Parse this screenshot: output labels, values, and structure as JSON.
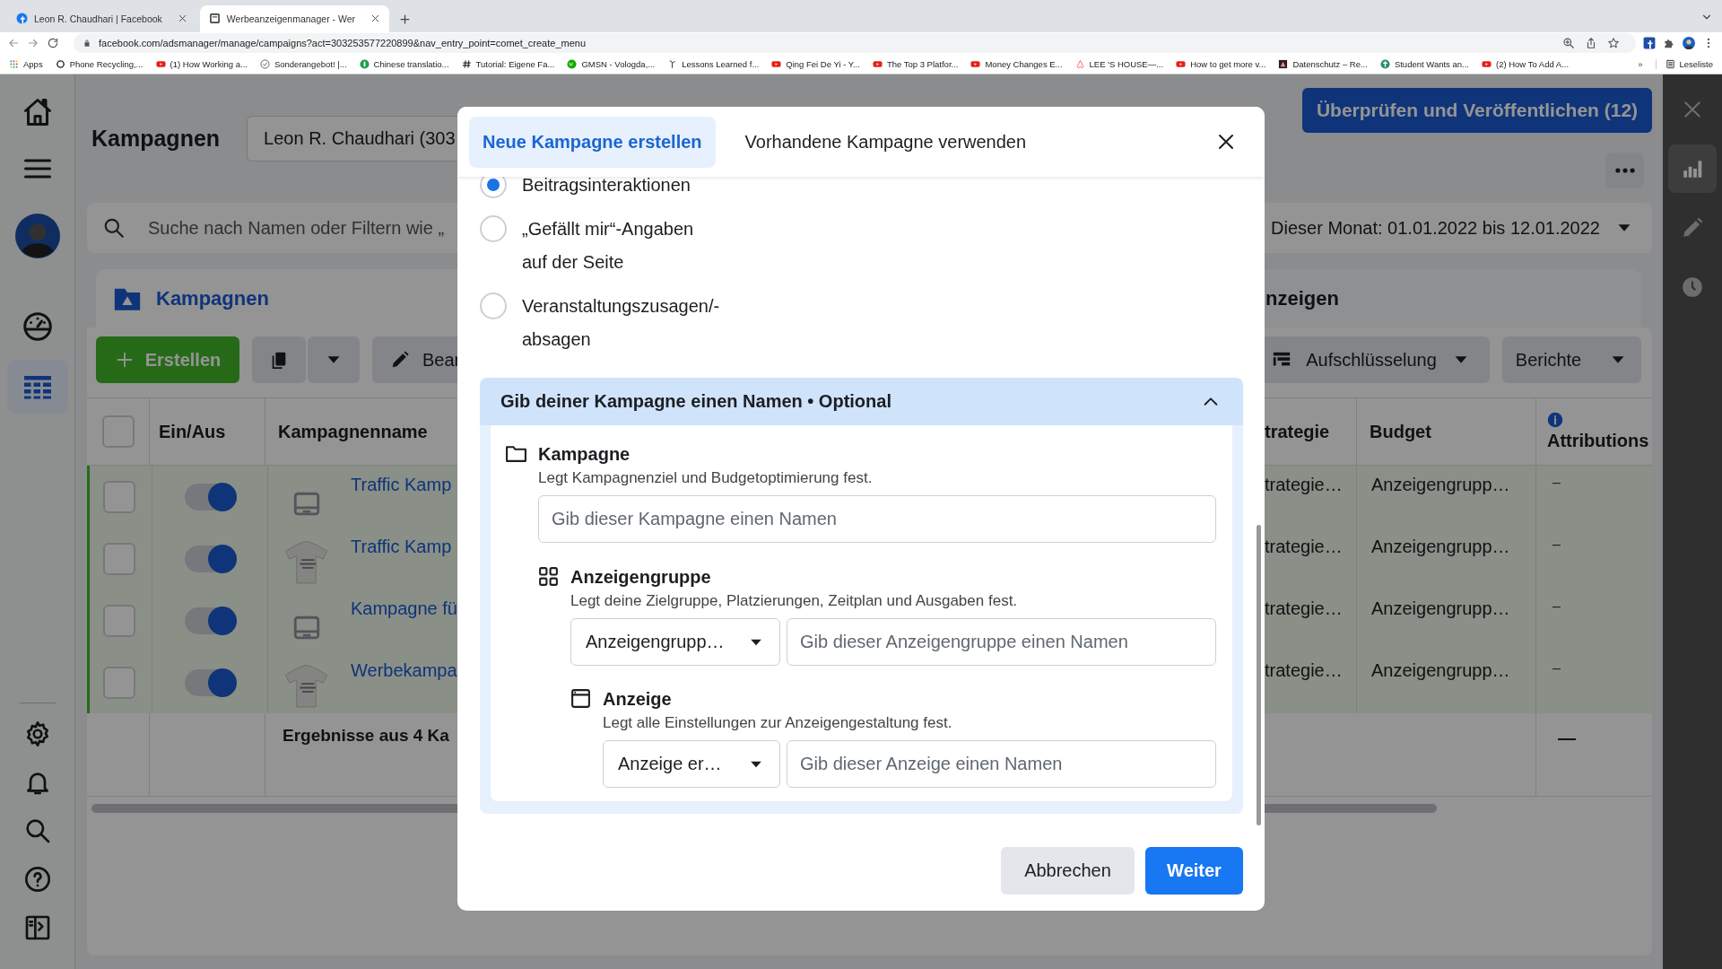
{
  "browser": {
    "tabs": [
      {
        "title": "Leon R. Chaudhari | Facebook",
        "selected": false
      },
      {
        "title": "Werbeanzeigenmanager - Wer",
        "selected": true
      }
    ],
    "address": "facebook.com/adsmanager/manage/campaigns?act=303253577220899&nav_entry_point=comet_create_menu",
    "bookmarks": [
      {
        "label": "Apps"
      },
      {
        "label": "Phone Recycling,..."
      },
      {
        "label": "(1) How Working a..."
      },
      {
        "label": "Sonderangebot! |..."
      },
      {
        "label": "Chinese translatio..."
      },
      {
        "label": "Tutorial: Eigene Fa..."
      },
      {
        "label": "GMSN - Vologda,..."
      },
      {
        "label": "Lessons Learned f..."
      },
      {
        "label": "Qing Fei De Yi - Y..."
      },
      {
        "label": "The Top 3 Platfor..."
      },
      {
        "label": "Money Changes E..."
      },
      {
        "label": "LEE 'S HOUSE—..."
      },
      {
        "label": "How to get more v..."
      },
      {
        "label": "Datenschutz – Re..."
      },
      {
        "label": "Student Wants an..."
      },
      {
        "label": "(2) How To Add A..."
      }
    ],
    "more_bookmarks": "»",
    "reading_list": "Leseliste"
  },
  "header": {
    "title": "Kampagnen",
    "account": "Leon R. Chaudhari (303",
    "publish": "Überprüfen und Veröffentlichen (12)"
  },
  "search": {
    "placeholder": "Suche nach Namen oder Filtern wie „",
    "date_range": "Dieser Monat: 01.01.2022 bis 12.01.2022"
  },
  "level_tabs": [
    {
      "label": "Kampagnen",
      "selected": true
    },
    {
      "label": "nzeigen",
      "selected": false
    }
  ],
  "toolbar": {
    "create": "Erstellen",
    "edit": "Bear",
    "breakdown": "Aufschlüsselung",
    "reports": "Berichte"
  },
  "table": {
    "all_checked": false,
    "columns": [
      "Ein/Aus",
      "Kampagnenname",
      "trategie",
      "Budget",
      "Attributions"
    ],
    "rows": [
      {
        "checked": false,
        "on": true,
        "kind": "placeholder",
        "name": "Traffic Kamp",
        "strategy": "trategie…",
        "budget": "Anzeigengrupp…",
        "attribution": "–"
      },
      {
        "checked": false,
        "on": true,
        "kind": "image",
        "name": "Traffic Kamp",
        "strategy": "trategie…",
        "budget": "Anzeigengrupp…",
        "attribution": "–"
      },
      {
        "checked": false,
        "on": true,
        "kind": "placeholder",
        "name": "Kampagne fü",
        "strategy": "trategie…",
        "budget": "Anzeigengrupp…",
        "attribution": "–"
      },
      {
        "checked": false,
        "on": true,
        "kind": "image",
        "name": "Werbekampa",
        "strategy": "trategie…",
        "budget": "Anzeigengrupp…",
        "attribution": "–"
      }
    ],
    "summary": {
      "label": "Ergebnisse aus 4 Ka",
      "attribution": "—"
    }
  },
  "modal": {
    "tabs": [
      {
        "label": "Neue Kampagne erstellen",
        "selected": true
      },
      {
        "label": "Vorhandene Kampagne verwenden",
        "selected": false
      }
    ],
    "options": [
      {
        "label": "Beitragsinteraktionen",
        "selected": true
      },
      {
        "label": "„Gefällt mir“-Angaben auf der Seite",
        "selected": false
      },
      {
        "label": "Veranstaltungszusagen/-absagen",
        "selected": false
      }
    ],
    "section": {
      "title": "Gib deiner Kampagne einen Namen • Optional",
      "expanded": true
    },
    "levels": [
      {
        "kind": "campaign",
        "title": "Kampagne",
        "description": "Legt Kampagnenziel und Budgetoptimierung fest.",
        "placeholder": "Gib dieser Kampagne einen Namen"
      },
      {
        "kind": "adset",
        "title": "Anzeigengruppe",
        "description": "Legt deine Zielgruppe, Platzierungen, Zeitplan und Ausgaben fest.",
        "select": "Anzeigengrupp…",
        "placeholder": "Gib dieser Anzeigengruppe einen Namen"
      },
      {
        "kind": "ad",
        "title": "Anzeige",
        "description": "Legt alle Einstellungen zur Anzeigengestaltung fest.",
        "select": "Anzeige er…",
        "placeholder": "Gib dieser Anzeige einen Namen"
      }
    ],
    "buttons": [
      {
        "label": "Abbrechen",
        "kind": "secondary"
      },
      {
        "label": "Weiter",
        "kind": "primary"
      }
    ]
  }
}
